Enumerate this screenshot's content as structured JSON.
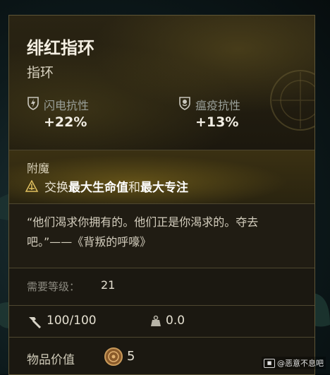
{
  "item": {
    "name": "绯红指环",
    "type": "指环"
  },
  "stats": [
    {
      "label": "闪电抗性",
      "value": "+22%",
      "icon": "lightning-shield-icon"
    },
    {
      "label": "瘟疫抗性",
      "value": "+13%",
      "icon": "plague-shield-icon"
    }
  ],
  "enchant": {
    "title": "附魔",
    "icon": "enchant-rune-icon",
    "prefix": "交换",
    "stat_a": "最大生命值",
    "joiner": "和",
    "stat_b": "最大专注"
  },
  "flavor": "“他们渴求你拥有的。他们正是你渴求的。夺去吧。”——《背叛的呼嚎》",
  "requirement": {
    "label": "需要等级：",
    "value": "21"
  },
  "durability": {
    "icon": "hammer-icon",
    "value": "100/100"
  },
  "weight": {
    "icon": "weight-icon",
    "value": "0.0"
  },
  "worth": {
    "label": "物品价值",
    "icon": "coin-icon",
    "value": "5"
  },
  "watermark": "@恶意不息吧"
}
